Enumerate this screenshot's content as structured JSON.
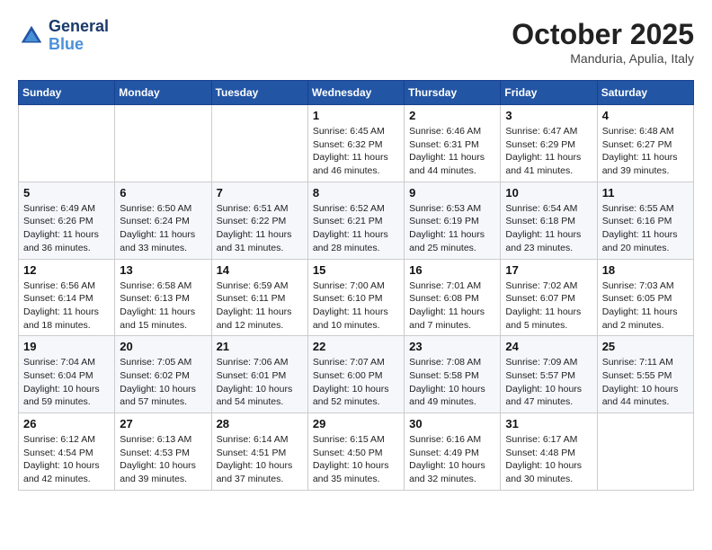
{
  "header": {
    "logo_line1": "General",
    "logo_line2": "Blue",
    "month": "October 2025",
    "location": "Manduria, Apulia, Italy"
  },
  "weekdays": [
    "Sunday",
    "Monday",
    "Tuesday",
    "Wednesday",
    "Thursday",
    "Friday",
    "Saturday"
  ],
  "weeks": [
    [
      {
        "day": "",
        "info": ""
      },
      {
        "day": "",
        "info": ""
      },
      {
        "day": "",
        "info": ""
      },
      {
        "day": "1",
        "info": "Sunrise: 6:45 AM\nSunset: 6:32 PM\nDaylight: 11 hours\nand 46 minutes."
      },
      {
        "day": "2",
        "info": "Sunrise: 6:46 AM\nSunset: 6:31 PM\nDaylight: 11 hours\nand 44 minutes."
      },
      {
        "day": "3",
        "info": "Sunrise: 6:47 AM\nSunset: 6:29 PM\nDaylight: 11 hours\nand 41 minutes."
      },
      {
        "day": "4",
        "info": "Sunrise: 6:48 AM\nSunset: 6:27 PM\nDaylight: 11 hours\nand 39 minutes."
      }
    ],
    [
      {
        "day": "5",
        "info": "Sunrise: 6:49 AM\nSunset: 6:26 PM\nDaylight: 11 hours\nand 36 minutes."
      },
      {
        "day": "6",
        "info": "Sunrise: 6:50 AM\nSunset: 6:24 PM\nDaylight: 11 hours\nand 33 minutes."
      },
      {
        "day": "7",
        "info": "Sunrise: 6:51 AM\nSunset: 6:22 PM\nDaylight: 11 hours\nand 31 minutes."
      },
      {
        "day": "8",
        "info": "Sunrise: 6:52 AM\nSunset: 6:21 PM\nDaylight: 11 hours\nand 28 minutes."
      },
      {
        "day": "9",
        "info": "Sunrise: 6:53 AM\nSunset: 6:19 PM\nDaylight: 11 hours\nand 25 minutes."
      },
      {
        "day": "10",
        "info": "Sunrise: 6:54 AM\nSunset: 6:18 PM\nDaylight: 11 hours\nand 23 minutes."
      },
      {
        "day": "11",
        "info": "Sunrise: 6:55 AM\nSunset: 6:16 PM\nDaylight: 11 hours\nand 20 minutes."
      }
    ],
    [
      {
        "day": "12",
        "info": "Sunrise: 6:56 AM\nSunset: 6:14 PM\nDaylight: 11 hours\nand 18 minutes."
      },
      {
        "day": "13",
        "info": "Sunrise: 6:58 AM\nSunset: 6:13 PM\nDaylight: 11 hours\nand 15 minutes."
      },
      {
        "day": "14",
        "info": "Sunrise: 6:59 AM\nSunset: 6:11 PM\nDaylight: 11 hours\nand 12 minutes."
      },
      {
        "day": "15",
        "info": "Sunrise: 7:00 AM\nSunset: 6:10 PM\nDaylight: 11 hours\nand 10 minutes."
      },
      {
        "day": "16",
        "info": "Sunrise: 7:01 AM\nSunset: 6:08 PM\nDaylight: 11 hours\nand 7 minutes."
      },
      {
        "day": "17",
        "info": "Sunrise: 7:02 AM\nSunset: 6:07 PM\nDaylight: 11 hours\nand 5 minutes."
      },
      {
        "day": "18",
        "info": "Sunrise: 7:03 AM\nSunset: 6:05 PM\nDaylight: 11 hours\nand 2 minutes."
      }
    ],
    [
      {
        "day": "19",
        "info": "Sunrise: 7:04 AM\nSunset: 6:04 PM\nDaylight: 10 hours\nand 59 minutes."
      },
      {
        "day": "20",
        "info": "Sunrise: 7:05 AM\nSunset: 6:02 PM\nDaylight: 10 hours\nand 57 minutes."
      },
      {
        "day": "21",
        "info": "Sunrise: 7:06 AM\nSunset: 6:01 PM\nDaylight: 10 hours\nand 54 minutes."
      },
      {
        "day": "22",
        "info": "Sunrise: 7:07 AM\nSunset: 6:00 PM\nDaylight: 10 hours\nand 52 minutes."
      },
      {
        "day": "23",
        "info": "Sunrise: 7:08 AM\nSunset: 5:58 PM\nDaylight: 10 hours\nand 49 minutes."
      },
      {
        "day": "24",
        "info": "Sunrise: 7:09 AM\nSunset: 5:57 PM\nDaylight: 10 hours\nand 47 minutes."
      },
      {
        "day": "25",
        "info": "Sunrise: 7:11 AM\nSunset: 5:55 PM\nDaylight: 10 hours\nand 44 minutes."
      }
    ],
    [
      {
        "day": "26",
        "info": "Sunrise: 6:12 AM\nSunset: 4:54 PM\nDaylight: 10 hours\nand 42 minutes."
      },
      {
        "day": "27",
        "info": "Sunrise: 6:13 AM\nSunset: 4:53 PM\nDaylight: 10 hours\nand 39 minutes."
      },
      {
        "day": "28",
        "info": "Sunrise: 6:14 AM\nSunset: 4:51 PM\nDaylight: 10 hours\nand 37 minutes."
      },
      {
        "day": "29",
        "info": "Sunrise: 6:15 AM\nSunset: 4:50 PM\nDaylight: 10 hours\nand 35 minutes."
      },
      {
        "day": "30",
        "info": "Sunrise: 6:16 AM\nSunset: 4:49 PM\nDaylight: 10 hours\nand 32 minutes."
      },
      {
        "day": "31",
        "info": "Sunrise: 6:17 AM\nSunset: 4:48 PM\nDaylight: 10 hours\nand 30 minutes."
      },
      {
        "day": "",
        "info": ""
      }
    ]
  ]
}
